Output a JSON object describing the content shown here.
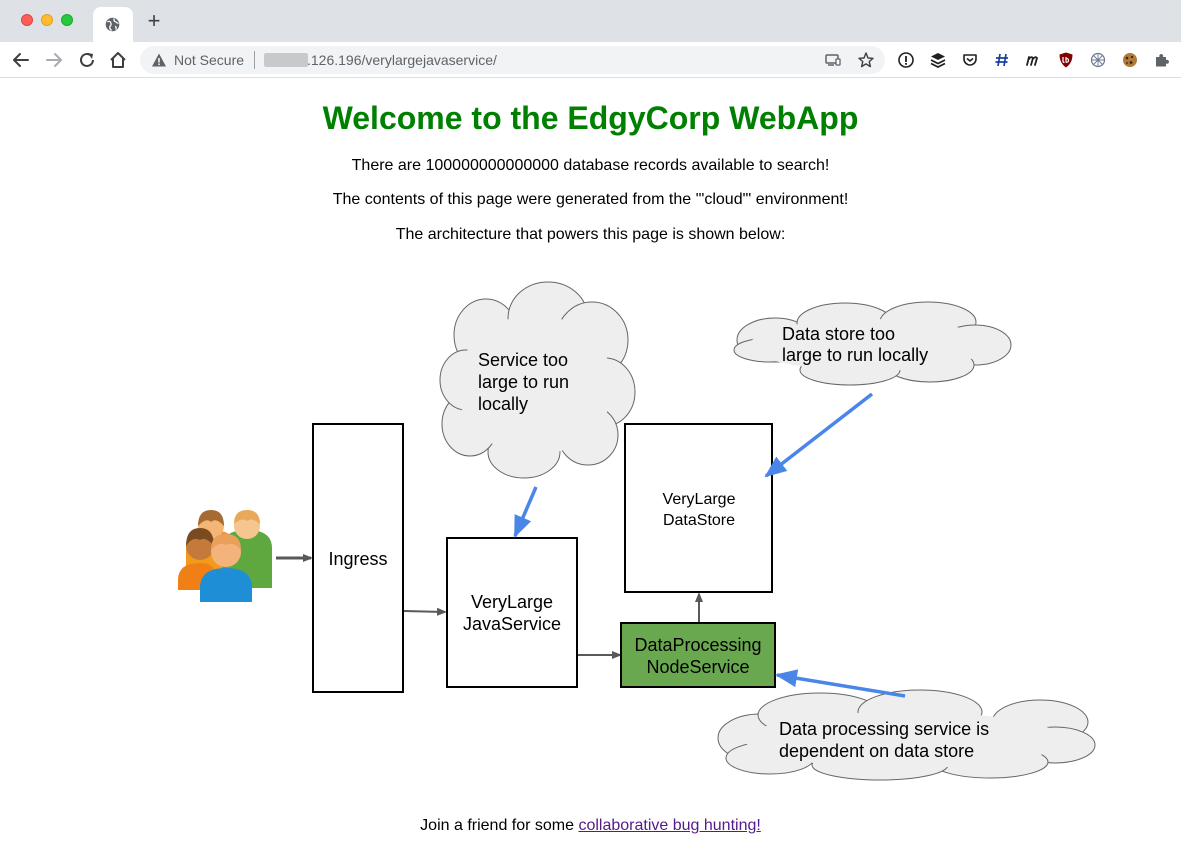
{
  "browser": {
    "security_label": "Not Secure",
    "url": ".126.196/verylargejavaservice/"
  },
  "page": {
    "title": "Welcome to the EdgyCorp WebApp",
    "records_line": "There are 100000000000000 database records available to search!",
    "environment_line": "The contents of this page were generated from the '\"cloud\"' environment!",
    "architecture_line": "The architecture that powers this page is shown below:",
    "footer_text": "Join a friend for some ",
    "footer_link": "collaborative bug hunting!"
  },
  "diagram": {
    "ingress": "Ingress",
    "java_service": [
      "VeryLarge",
      "JavaService"
    ],
    "data_store": [
      "VeryLarge",
      "DataStore"
    ],
    "data_processing": [
      "DataProcessing",
      "NodeService"
    ],
    "cloud_service": [
      "Service too",
      "large to run",
      "locally"
    ],
    "cloud_store": [
      "Data store too",
      "large to run locally"
    ],
    "cloud_processing": [
      "Data processing service is",
      "dependent on data store"
    ],
    "colors": {
      "title_green": "#008000",
      "node_green": "#6aa84f",
      "callout_arrow": "#4a86e8",
      "flow_arrow": "#595959",
      "cloud_fill": "#eeeeee"
    }
  }
}
